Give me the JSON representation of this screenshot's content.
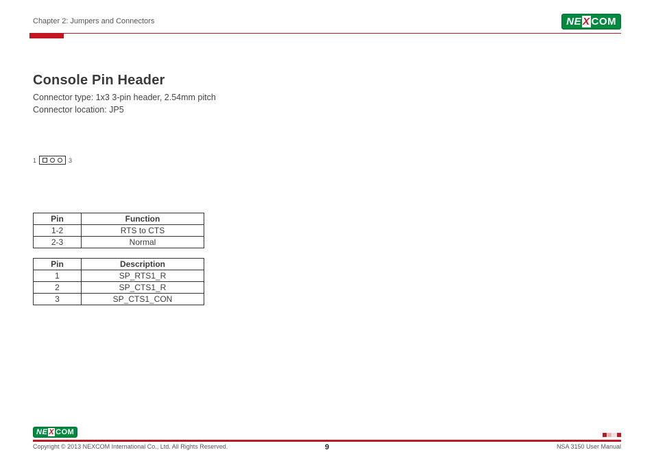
{
  "header": {
    "chapter": "Chapter 2: Jumpers and Connectors",
    "logo_text_left": "NE",
    "logo_text_x": "X",
    "logo_text_right": "COM"
  },
  "section": {
    "title": "Console Pin Header",
    "connector_type": "Connector type: 1x3 3-pin header, 2.54mm pitch",
    "connector_location": "Connector location: JP5"
  },
  "pin_diagram": {
    "left_label": "1",
    "right_label": "3"
  },
  "table_function": {
    "headers": {
      "pin": "Pin",
      "func": "Function"
    },
    "rows": [
      {
        "pin": "1-2",
        "func": "RTS to CTS"
      },
      {
        "pin": "2-3",
        "func": "Normal"
      }
    ]
  },
  "table_description": {
    "headers": {
      "pin": "Pin",
      "desc": "Description"
    },
    "rows": [
      {
        "pin": "1",
        "desc": "SP_RTS1_R"
      },
      {
        "pin": "2",
        "desc": "SP_CTS1_R"
      },
      {
        "pin": "3",
        "desc": "SP_CTS1_CON"
      }
    ]
  },
  "footer": {
    "copyright": "Copyright © 2013 NEXCOM International Co., Ltd. All Rights Reserved.",
    "page_number": "9",
    "manual": "NSA 3150 User Manual",
    "logo_text_left": "NE",
    "logo_text_x": "X",
    "logo_text_right": "COM"
  },
  "chart_data": [
    {
      "type": "table",
      "title": "Pin / Function",
      "columns": [
        "Pin",
        "Function"
      ],
      "rows": [
        [
          "1-2",
          "RTS to CTS"
        ],
        [
          "2-3",
          "Normal"
        ]
      ]
    },
    {
      "type": "table",
      "title": "Pin / Description",
      "columns": [
        "Pin",
        "Description"
      ],
      "rows": [
        [
          "1",
          "SP_RTS1_R"
        ],
        [
          "2",
          "SP_CTS1_R"
        ],
        [
          "3",
          "SP_CTS1_CON"
        ]
      ]
    }
  ]
}
